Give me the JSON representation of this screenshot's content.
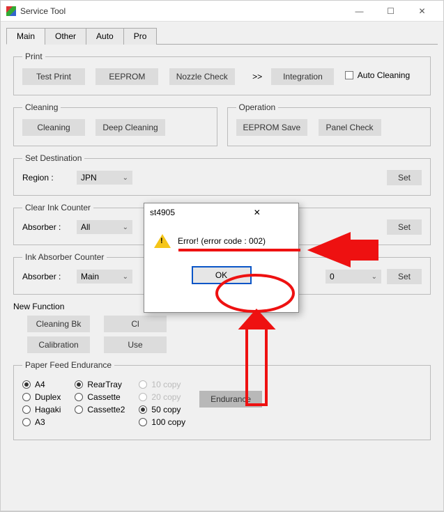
{
  "window": {
    "title": "Service Tool",
    "btn_min": "—",
    "btn_max": "☐",
    "btn_close": "✕"
  },
  "tabs": {
    "main": "Main",
    "other": "Other",
    "auto": "Auto",
    "pro": "Pro"
  },
  "print": {
    "legend": "Print",
    "test": "Test Print",
    "eeprom": "EEPROM",
    "nozzle": "Nozzle Check",
    "skip": ">>",
    "integration": "Integration",
    "auto_cleaning": "Auto Cleaning"
  },
  "cleaning": {
    "legend": "Cleaning",
    "cleaning": "Cleaning",
    "deep": "Deep Cleaning"
  },
  "operation": {
    "legend": "Operation",
    "eeprom_save": "EEPROM Save",
    "panel_check": "Panel Check"
  },
  "setdest": {
    "legend": "Set Destination",
    "region_lbl": "Region :",
    "region_val": "JPN",
    "set": "Set"
  },
  "clearink": {
    "legend": "Clear Ink Counter",
    "abs_lbl": "Absorber :",
    "abs_val": "All",
    "set": "Set"
  },
  "inkabs": {
    "legend": "Ink Absorber Counter",
    "abs_lbl": "Absorber :",
    "abs_val": "Main",
    "num_val": "0",
    "set": "Set"
  },
  "newfn": {
    "legend": "New Function",
    "cleaning_bk": "Cleaning Bk",
    "cl_partial": "Cl",
    "calibration": "Calibration",
    "use_partial": "Use"
  },
  "paperfeed": {
    "legend": "Paper Feed Endurance",
    "paper": {
      "a4": "A4",
      "duplex": "Duplex",
      "hagaki": "Hagaki",
      "a3": "A3"
    },
    "tray": {
      "rear": "RearTray",
      "cassette": "Cassette",
      "cassette2": "Cassette2"
    },
    "copies": {
      "c10": "10 copy",
      "c20": "20 copy",
      "c50": "50 copy",
      "c100": "100 copy"
    },
    "endurance": "Endurance"
  },
  "dialog": {
    "title": "st4905",
    "close": "✕",
    "msg": "Error! (error code : 002)",
    "ok": "OK"
  }
}
